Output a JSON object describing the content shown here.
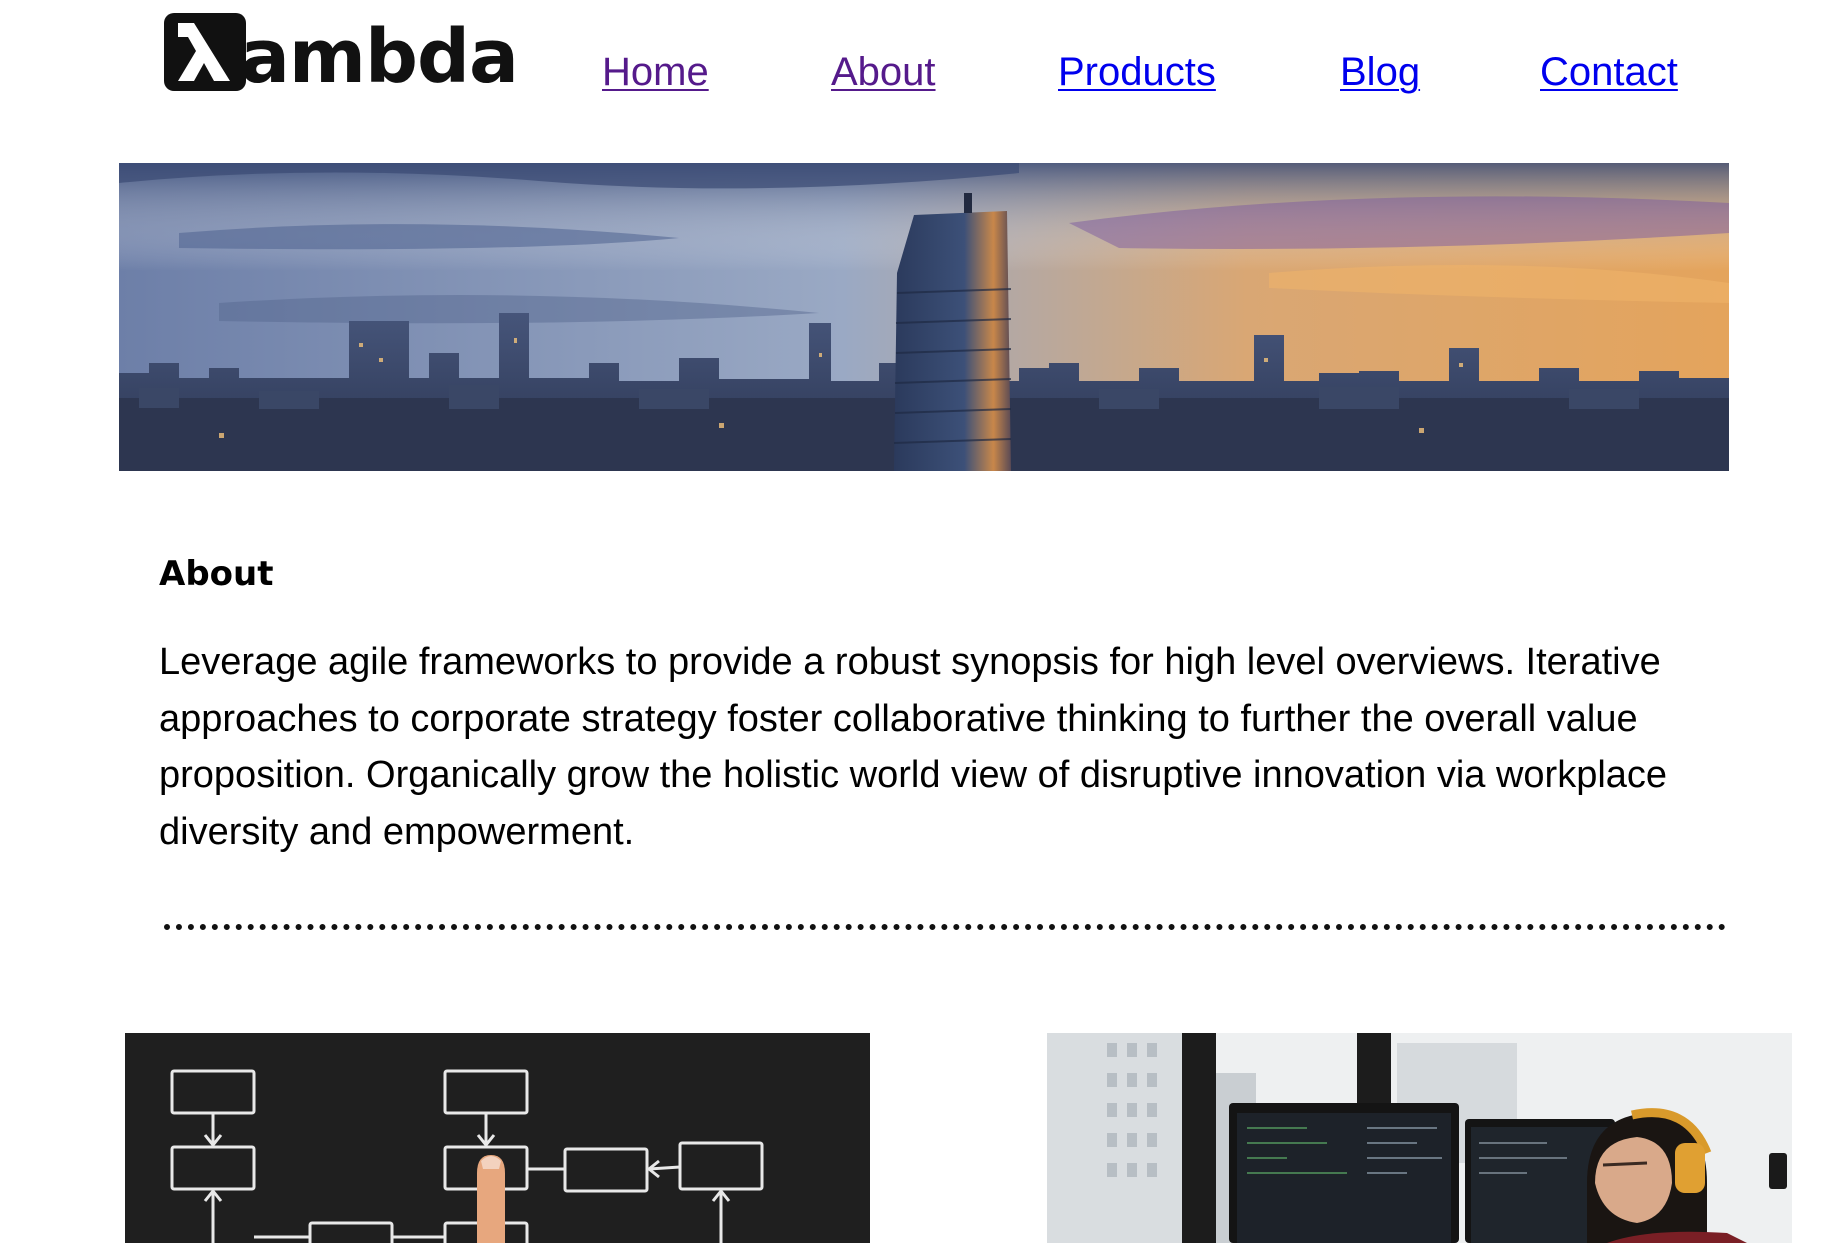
{
  "header": {
    "logo_text": "ambda",
    "logo_symbol": "λ",
    "nav": [
      {
        "label": "Home",
        "state": "visited"
      },
      {
        "label": "About",
        "state": "visited"
      },
      {
        "label": "Products",
        "state": "unvisited"
      },
      {
        "label": "Blog",
        "state": "unvisited"
      },
      {
        "label": "Contact",
        "state": "unvisited"
      }
    ]
  },
  "hero": {
    "image": "city-skyline-at-sunset"
  },
  "about": {
    "heading": "About",
    "body": "Leverage agile frameworks to provide a robust synopsis for high level overviews. Iterative approaches to corporate strategy foster collaborative thinking to further the overall value proposition. Organically grow the holistic world view of disruptive innovation via workplace diversity and empowerment."
  },
  "features": [
    {
      "image": "chalkboard-flowchart-with-finger"
    },
    {
      "image": "developer-with-headphones-at-monitors"
    }
  ],
  "colors": {
    "link": "#0000ee",
    "visited_link": "#551a8b",
    "text": "#000000",
    "background": "#ffffff"
  }
}
